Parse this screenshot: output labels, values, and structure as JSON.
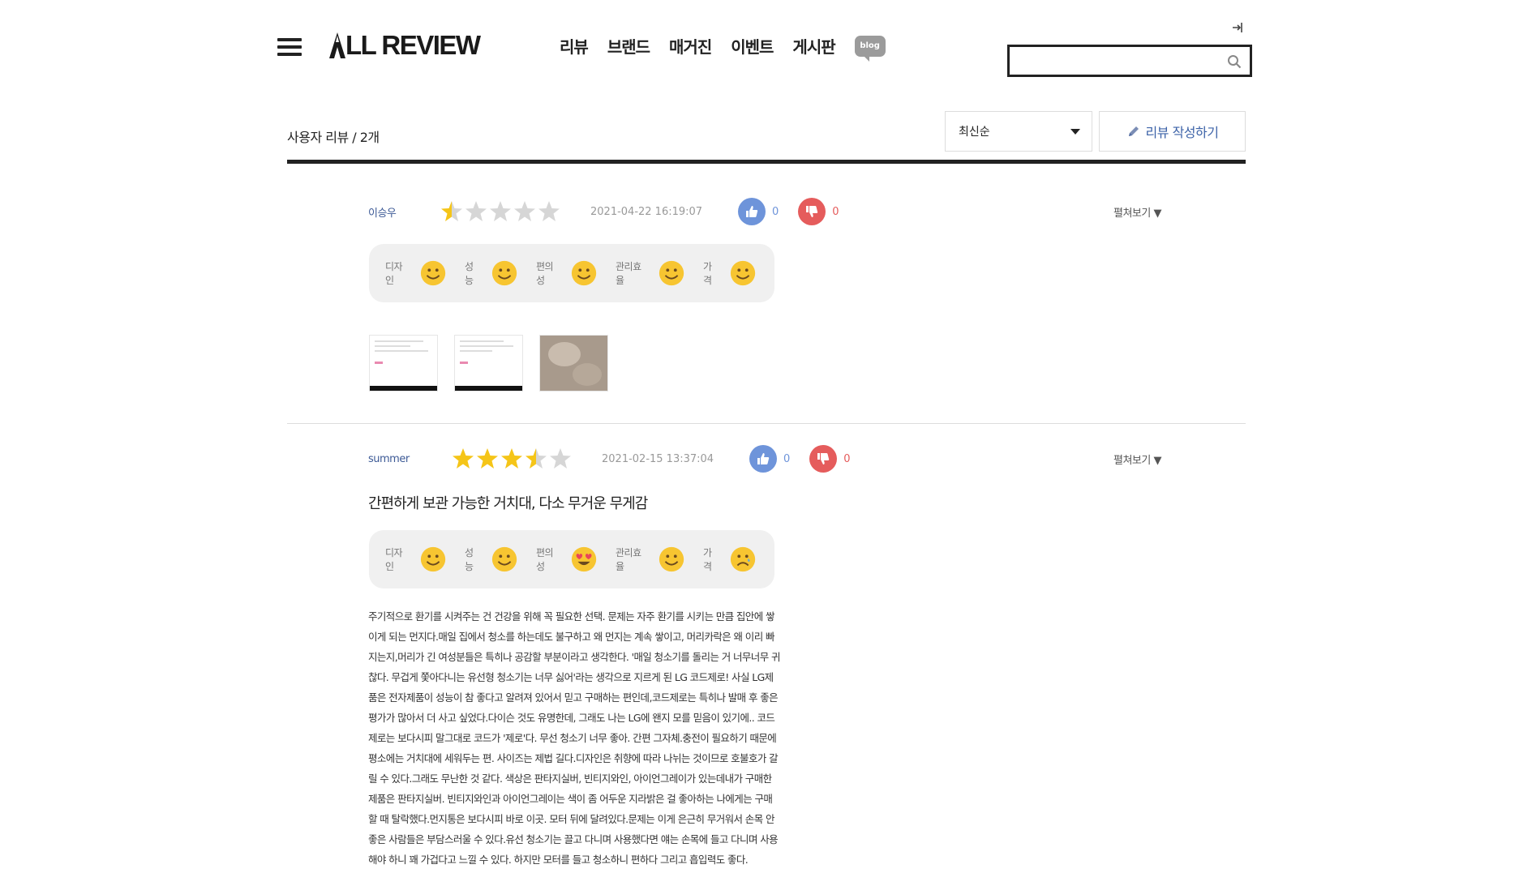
{
  "header": {
    "logo_text": "LL REVIEW",
    "nav": [
      "리뷰",
      "브랜드",
      "매거진",
      "이벤트",
      "게시판"
    ],
    "blog_label": "blog",
    "search": {
      "value": "",
      "placeholder": ""
    }
  },
  "review_list": {
    "title": "사용자 리뷰 / 2개",
    "sort_selected": "최신순",
    "write_button": "리뷰 작성하기"
  },
  "reviews": [
    {
      "author": "이승우",
      "rating": 1,
      "date": "2021-04-22 16:19:07",
      "likes": "0",
      "dislikes": "0",
      "expand_label": "펼쳐보기 ▼",
      "ratings": [
        {
          "label": "디자인",
          "face": "smile"
        },
        {
          "label": "성능",
          "face": "smile"
        },
        {
          "label": "편의성",
          "face": "smile"
        },
        {
          "label": "관리효율",
          "face": "smile"
        },
        {
          "label": "가격",
          "face": "smile"
        }
      ]
    },
    {
      "author": "summer",
      "rating": 3.5,
      "date": "2021-02-15 13:37:04",
      "likes": "0",
      "dislikes": "0",
      "expand_label": "펼쳐보기 ▼",
      "title": "간편하게 보관 가능한 거치대, 다소 무거운 무게감",
      "ratings": [
        {
          "label": "디자인",
          "face": "smile"
        },
        {
          "label": "성능",
          "face": "smile"
        },
        {
          "label": "편의성",
          "face": "heart-eyes"
        },
        {
          "label": "관리효율",
          "face": "smile"
        },
        {
          "label": "가격",
          "face": "sad"
        }
      ],
      "body": "주기적으로 환기를 시켜주는 건 건강을 위해 꼭 필요한 선택. 문제는 자주 환기를 시키는 만큼 집안에 쌓이게 되는 먼지다.매일 집에서 청소를 하는데도 불구하고 왜 먼지는 계속 쌓이고, 머리카락은 왜 이리 빠지는지,머리가 긴 여성분들은 특히나 공감할 부분이라고 생각한다. '매일 청소기를 돌리는 거 너무너무 귀찮다. 무겁게 쫓아다니는 유선형 청소기는 너무 싫어'라는 생각으로 지르게 된 LG 코드제로! 사실 LG제품은 전자제품이 성능이 참 좋다고 알려져 있어서 믿고 구매하는 편인데,코드제로는 특히나 발매 후 좋은 평가가 많아서 더 사고 싶었다.다이슨 것도 유명한데, 그래도 나는 LG에 왠지 모를 믿음이 있기에.. 코드제로는 보다시피 말그대로 코드가 '제로'다. 무선 청소기 너무 좋아. 간편 그자체.충전이 필요하기 때문에 평소에는 거치대에 세워두는 편. 사이즈는 제법 길다.디자인은 취향에 따라 나뉘는 것이므로 호불호가 갈릴 수 있다.그래도 무난한 것 같다. 색상은 판타지실버, 빈티지와인, 아이언그레이가 있는데내가 구매한 제품은 판타지실버. 빈티지와인과 아이언그레이는 색이 좀 어두운 지라밝은 걸 좋아하는 나에게는 구매할 때 탈락했다.먼지통은 보다시피 바로 이곳. 모터 뒤에 달려있다.문제는 이게 은근히 무거워서 손목 안 좋은 사람들은 부담스러울 수 있다.유선 청소기는 끌고 다니며 사용했다면 얘는 손목에 들고 다니며 사용해야 하니 꽤 가겁다고 느낄 수 있다. 하지만 모터를 들고 청소하니 편하다 그리고 흡입력도 좋다."
    }
  ]
}
